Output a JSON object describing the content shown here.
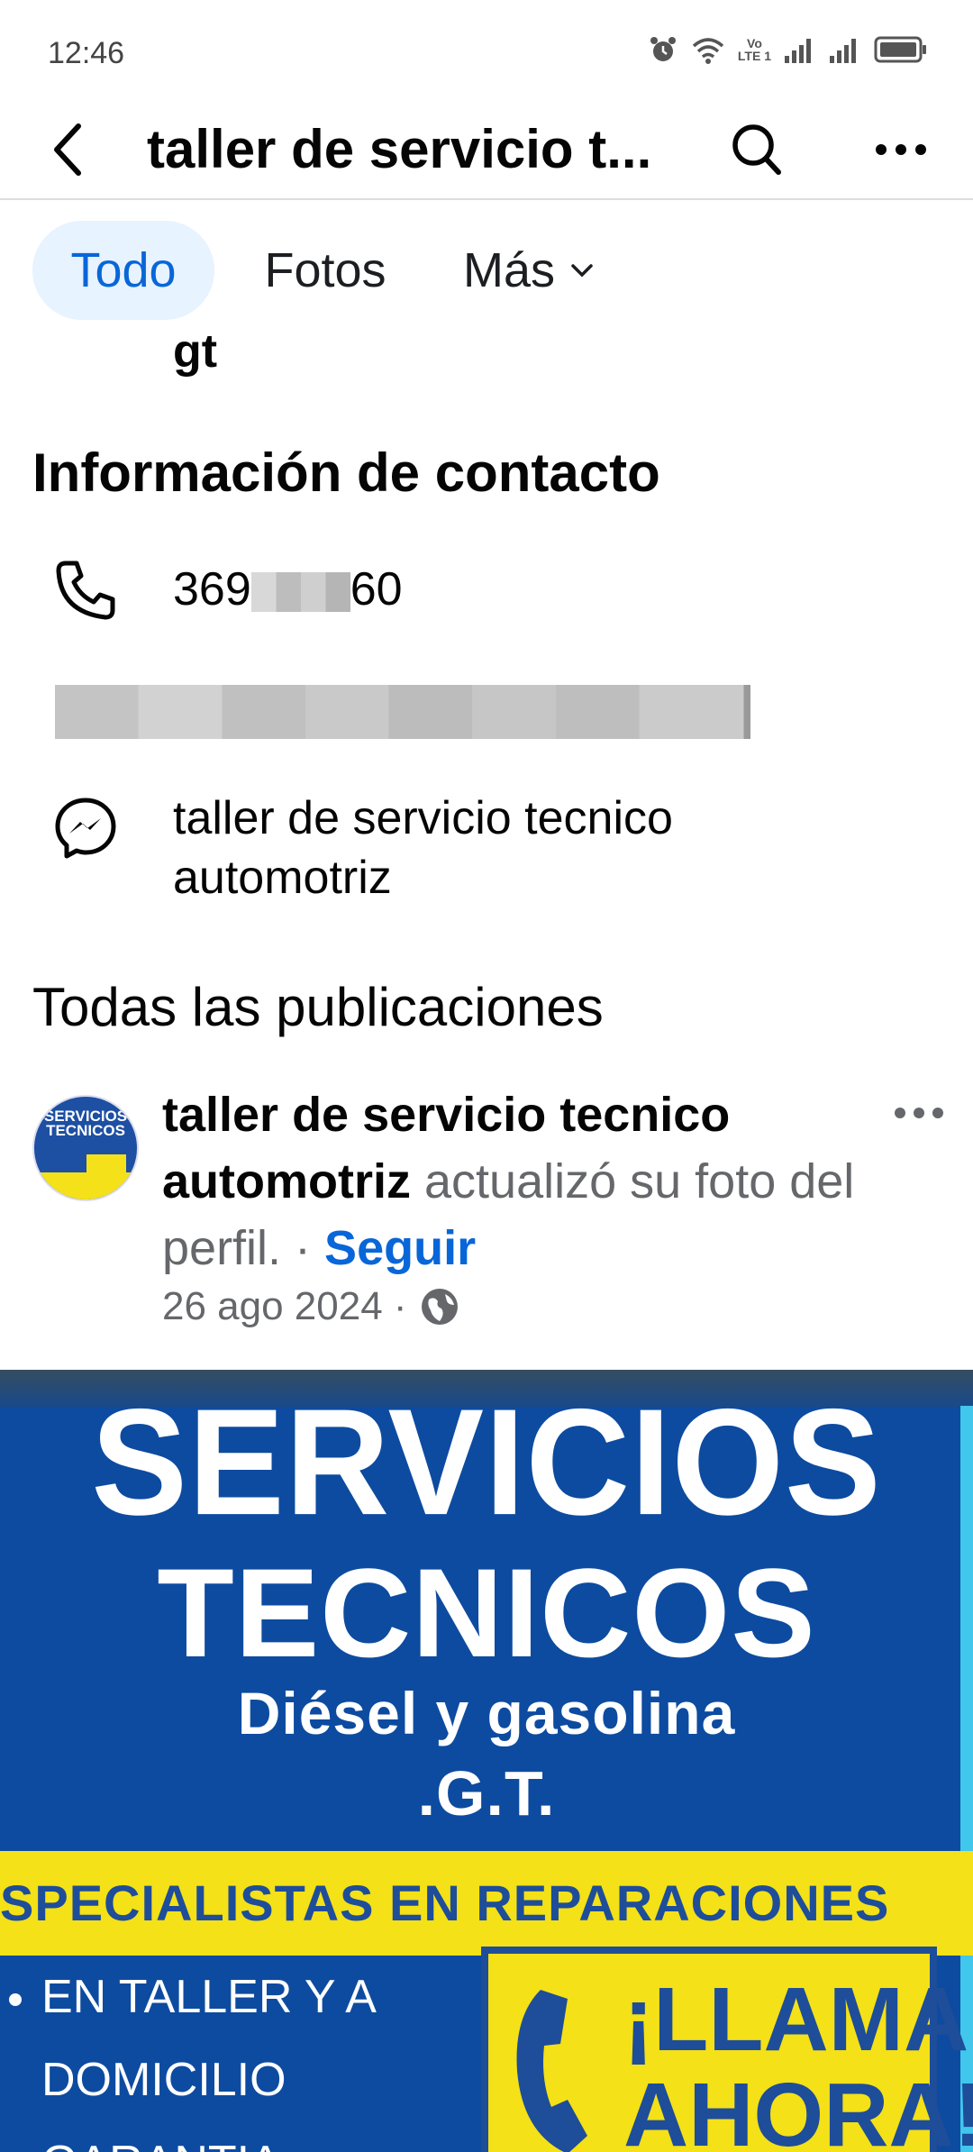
{
  "status_bar": {
    "time": "12:46",
    "network_label": "Vo\nLTE 1"
  },
  "header": {
    "title": "taller de servicio t...",
    "back_icon": "back-arrow-icon",
    "search_icon": "search-icon",
    "more_icon": "more-dots-icon"
  },
  "tabs": [
    {
      "label": "Todo",
      "active": true
    },
    {
      "label": "Fotos",
      "active": false
    },
    {
      "label": "Más",
      "active": false
    }
  ],
  "cut_text": "gt",
  "contact": {
    "title": "Información de contacto",
    "phone_prefix": "369",
    "phone_suffix": "60",
    "messenger_label": "taller de servicio tecnico automotriz"
  },
  "posts": {
    "title": "Todas las publicaciones",
    "author": "taller de servicio tecnico automotriz",
    "action": " actualizó su foto del perfil. · ",
    "follow": "Seguir",
    "date": "26 ago 2024 ·",
    "audience_icon": "globe-icon",
    "avatar_text": "SERVICIOS TECNICOS",
    "image": {
      "line1": "SERVICIOS",
      "line2": "TECNICOS",
      "line3": "Diésel y gasolina",
      "line4": ".G.T.",
      "banner": "SPECIALISTAS EN REPARACIONES",
      "item1": "EN TALLER Y A",
      "item2": "DOMICILIO",
      "item3": "GARANTIA",
      "call1": "¡LLAMA",
      "call2": "AHORA!"
    }
  },
  "colors": {
    "accent": "#0866d8",
    "tab_active_bg": "#e7f3ff",
    "image_blue": "#0d4ba0",
    "image_yellow": "#f4e117"
  }
}
